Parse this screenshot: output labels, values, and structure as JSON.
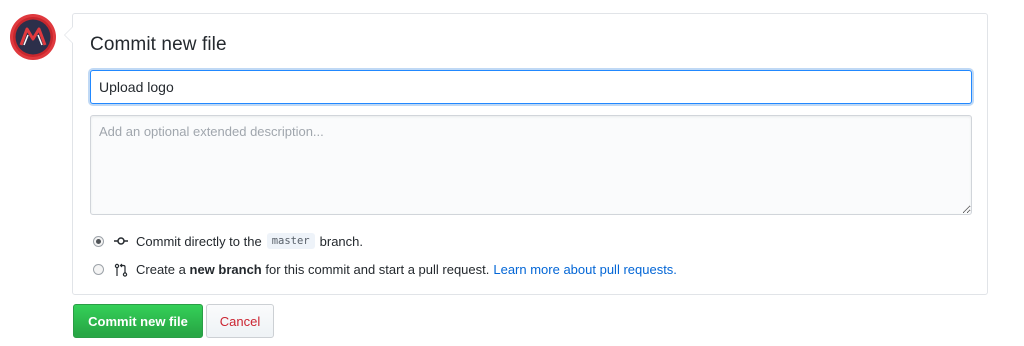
{
  "avatar": {
    "alt": "user avatar",
    "colors": {
      "ring": "#e0393e",
      "inner": "#2c2f4a"
    }
  },
  "commit_form": {
    "title": "Commit new file",
    "summary_value": "Upload logo",
    "description_placeholder": "Add an optional extended description...",
    "options": [
      {
        "id": "direct",
        "selected": true,
        "icon": "git-commit-icon",
        "text_before": "Commit directly to the",
        "branch": "master",
        "text_after": "branch."
      },
      {
        "id": "new-branch",
        "selected": false,
        "icon": "git-pull-request-icon",
        "text_before": "Create a",
        "bold": "new branch",
        "text_after": "for this commit and start a pull request.",
        "link": "Learn more about pull requests."
      }
    ]
  },
  "buttons": {
    "commit_label": "Commit new file",
    "cancel_label": "Cancel"
  },
  "colors": {
    "primary": "#28a745",
    "link": "#0366d6",
    "danger": "#cb2431",
    "focus": "#2188ff"
  }
}
